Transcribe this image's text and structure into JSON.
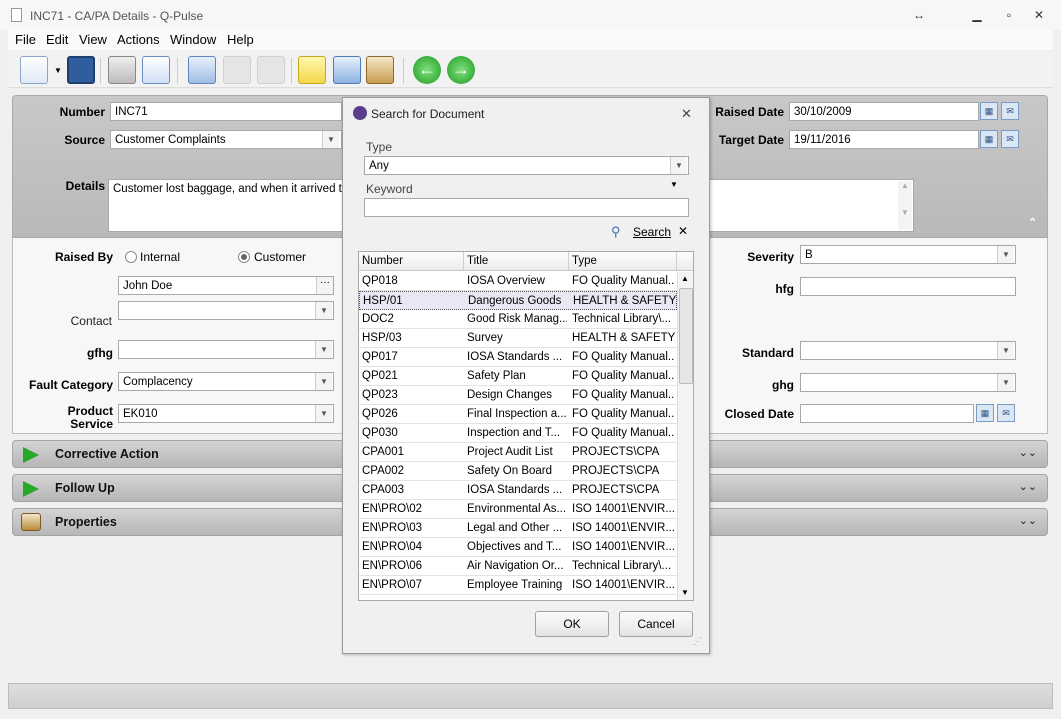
{
  "window": {
    "title": "INC71 - CA/PA Details - Q-Pulse"
  },
  "menu": {
    "file": "File",
    "edit": "Edit",
    "view": "View",
    "actions": "Actions",
    "window": "Window",
    "help": "Help"
  },
  "form": {
    "number_label": "Number",
    "number_value": "INC71",
    "source_label": "Source",
    "source_value": "Customer Complaints",
    "details_label": "Details",
    "details_value": "Customer lost baggage, and when it arrived the",
    "raised_date_label": "Raised Date",
    "raised_date_value": "30/10/2009",
    "target_date_label": "Target Date",
    "target_date_value": "19/11/2016",
    "raised_by_label": "Raised By",
    "internal_label": "Internal",
    "customer_label": "Customer",
    "contact_name": "John Doe",
    "contact_label": "Contact",
    "gfhg_label": "gfhg",
    "fault_label": "Fault Category",
    "fault_value": "Complacency",
    "product_label1": "Product",
    "product_label2": "Service",
    "product_value": "EK010",
    "severity_label": "Severity",
    "severity_value": "B",
    "hfg_label": "hfg",
    "standard_label": "Standard",
    "ghg_label": "ghg",
    "closed_date_label": "Closed Date"
  },
  "sections": {
    "corrective": "Corrective Action",
    "follow_up": "Follow Up",
    "properties": "Properties"
  },
  "dialog": {
    "title": "Search for Document",
    "type_label": "Type",
    "type_value": "Any",
    "keyword_label": "Keyword",
    "keyword_value": "",
    "search_label": "Search",
    "columns": [
      "Number",
      "Title",
      "Type"
    ],
    "rows": [
      [
        "QP018",
        "IOSA Overview",
        "FO Quality Manual..."
      ],
      [
        "HSP/01",
        "Dangerous Goods",
        "HEALTH & SAFETY..."
      ],
      [
        "DOC2",
        "Good Risk Manag...",
        "Technical Library\\..."
      ],
      [
        "HSP/03",
        "Survey",
        "HEALTH & SAFETY..."
      ],
      [
        "QP017",
        "IOSA Standards ...",
        "FO Quality Manual..."
      ],
      [
        "QP021",
        "Safety Plan",
        "FO Quality Manual..."
      ],
      [
        "QP023",
        "Design Changes",
        "FO Quality Manual..."
      ],
      [
        "QP026",
        "Final Inspection a...",
        "FO Quality Manual..."
      ],
      [
        "QP030",
        "Inspection and T...",
        "FO Quality Manual..."
      ],
      [
        "CPA001",
        "Project Audit List",
        "PROJECTS\\CPA"
      ],
      [
        "CPA002",
        "Safety On Board",
        "PROJECTS\\CPA"
      ],
      [
        "CPA003",
        "IOSA Standards ...",
        "PROJECTS\\CPA"
      ],
      [
        "EN\\PRO\\02",
        "Environmental As...",
        "ISO 14001\\ENVIR..."
      ],
      [
        "EN\\PRO\\03",
        "Legal and Other ...",
        "ISO 14001\\ENVIR..."
      ],
      [
        "EN\\PRO\\04",
        "Objectives and T...",
        "ISO 14001\\ENVIR..."
      ],
      [
        "EN\\PRO\\06",
        "Air Navigation Or...",
        "Technical Library\\..."
      ],
      [
        "EN\\PRO\\07",
        "Employee Training",
        "ISO 14001\\ENVIR..."
      ]
    ],
    "ok_label": "OK",
    "cancel_label": "Cancel"
  }
}
